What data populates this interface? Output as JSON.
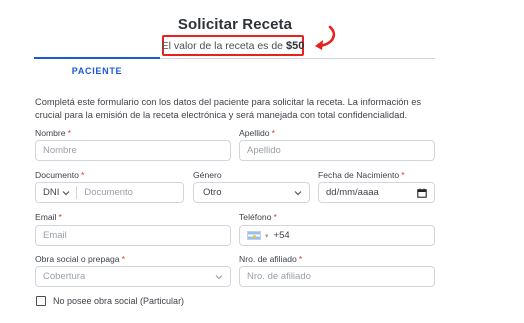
{
  "title": "Solicitar Receta",
  "price": {
    "prefix": "El valor de la receta es de",
    "amount": "$50"
  },
  "tab": {
    "label": "PACIENTE"
  },
  "intro": "Completá este formulario con los datos del paciente para solicitar la receta. La información es crucial para la emisión de la receta electrónica y será manejada con total confidencialidad.",
  "required_mark": "*",
  "fields": {
    "nombre": {
      "label": "Nombre",
      "placeholder": "Nombre"
    },
    "apellido": {
      "label": "Apellido",
      "placeholder": "Apellido"
    },
    "documento": {
      "label": "Documento",
      "type_value": "DNI",
      "placeholder": "Documento"
    },
    "genero": {
      "label": "Género",
      "value": "Otro"
    },
    "fecha": {
      "label": "Fecha de Nacimiento",
      "placeholder": "dd/mm/aaaa"
    },
    "email": {
      "label": "Email",
      "placeholder": "Email"
    },
    "telefono": {
      "label": "Teléfono",
      "value": "+54"
    },
    "obra_social": {
      "label": "Obra social o prepaga",
      "placeholder": "Cobertura"
    },
    "afiliado": {
      "label": "Nro. de afiliado",
      "placeholder": "Nro. de afiliado"
    }
  },
  "checkbox": {
    "label": "No posee obra social (Particular)",
    "checked": false
  },
  "colors": {
    "accent": "#1d58d8",
    "highlight": "#e8211e",
    "required": "#e03131"
  }
}
